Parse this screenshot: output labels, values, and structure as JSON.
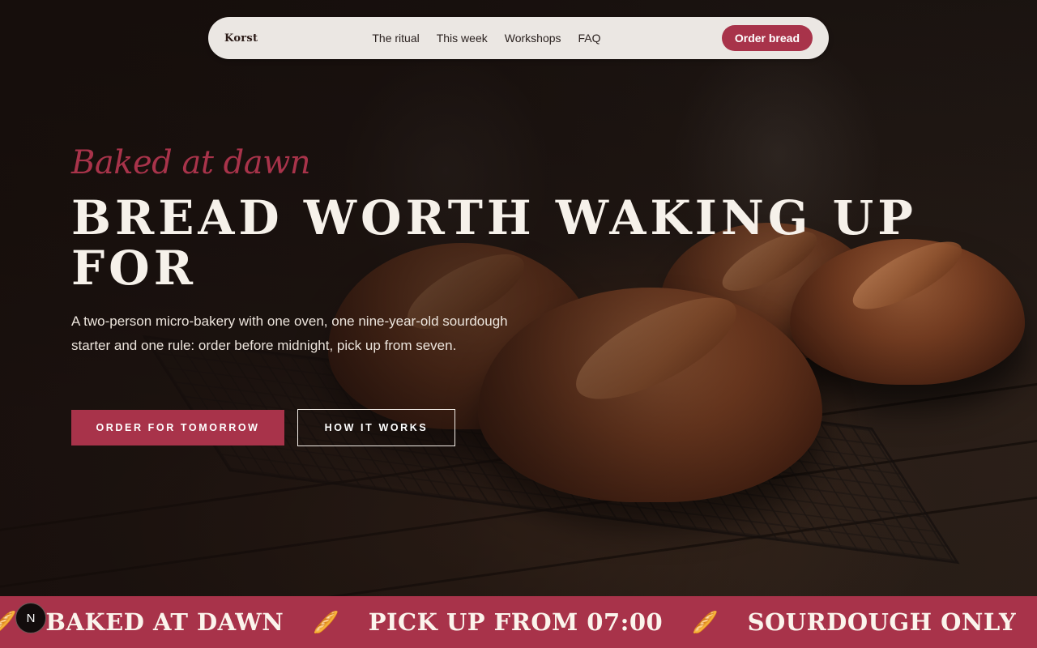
{
  "nav": {
    "brand": "Korst",
    "links": [
      "The ritual",
      "This week",
      "Workshops",
      "FAQ"
    ],
    "cta": "Order bread"
  },
  "hero": {
    "eyebrow": "Baked at dawn",
    "headline": "Bread worth waking up for",
    "lede": "A two-person micro-bakery with one oven, one nine-year-old sourdough starter and one rule: order before midnight, pick up from seven.",
    "primary_cta": "ORDER FOR TOMORROW",
    "secondary_cta": "HOW IT WORKS"
  },
  "marquee": {
    "items": [
      "BAKED AT DAWN",
      "PICK UP FROM 07:00",
      "SOURDOUGH ONLY"
    ],
    "icon": "bread-icon",
    "icon_glyph": "🥖"
  },
  "badge": {
    "label": "N",
    "icon": "n-logo-icon"
  },
  "colors": {
    "accent": "#a8334a",
    "nav_bg": "#ebe7e3",
    "dark": "#1a1310"
  }
}
